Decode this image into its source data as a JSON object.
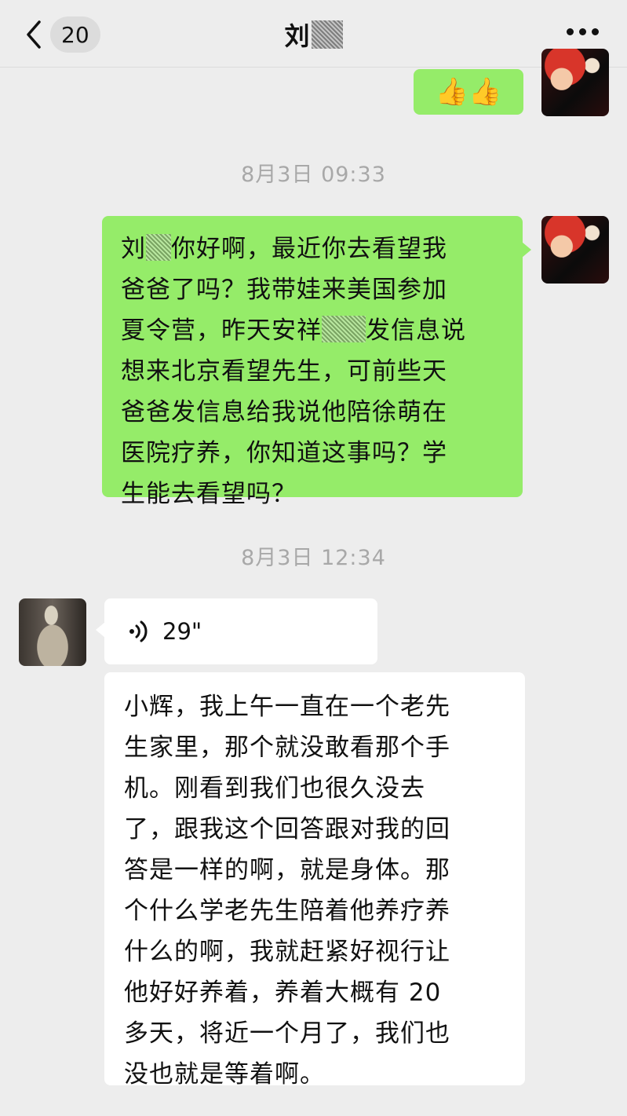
{
  "header": {
    "back_count": "20",
    "title": "刘",
    "more_icon": "more-dots-icon"
  },
  "messages": [
    {
      "type": "emoji",
      "sender": "self",
      "content": "👍👍"
    },
    {
      "type": "time",
      "text": "8月3日 09:33"
    },
    {
      "type": "text",
      "sender": "self",
      "lines": [
        "刘",
        "你好啊，最近你去看望我",
        "爸爸了吗？我带娃来美国参加",
        "夏令营，昨天安祥",
        "发信息说",
        "想来北京看望先生，可前些天",
        "爸爸发信息给我说他陪徐萌在",
        "医院疗养，你知道这事吗？学",
        "生能去看望吗？"
      ]
    },
    {
      "type": "time",
      "text": "8月3日 12:34"
    },
    {
      "type": "voice",
      "sender": "other",
      "duration": "29\""
    },
    {
      "type": "text",
      "sender": "other",
      "lines": [
        "小辉，我上午一直在一个老先",
        "生家里，那个就没敢看那个手",
        "机。刚看到我们也很久没去",
        "了，跟我这个回答跟对我的回",
        "答是一样的啊，就是身体。那",
        "个什么学老先生陪着他养疗养",
        "什么的啊，我就赶紧好视行让",
        "他好好养着，养着大概有 20",
        "多天，将近一个月了，我们也",
        "没也就是等着啊。"
      ]
    }
  ]
}
